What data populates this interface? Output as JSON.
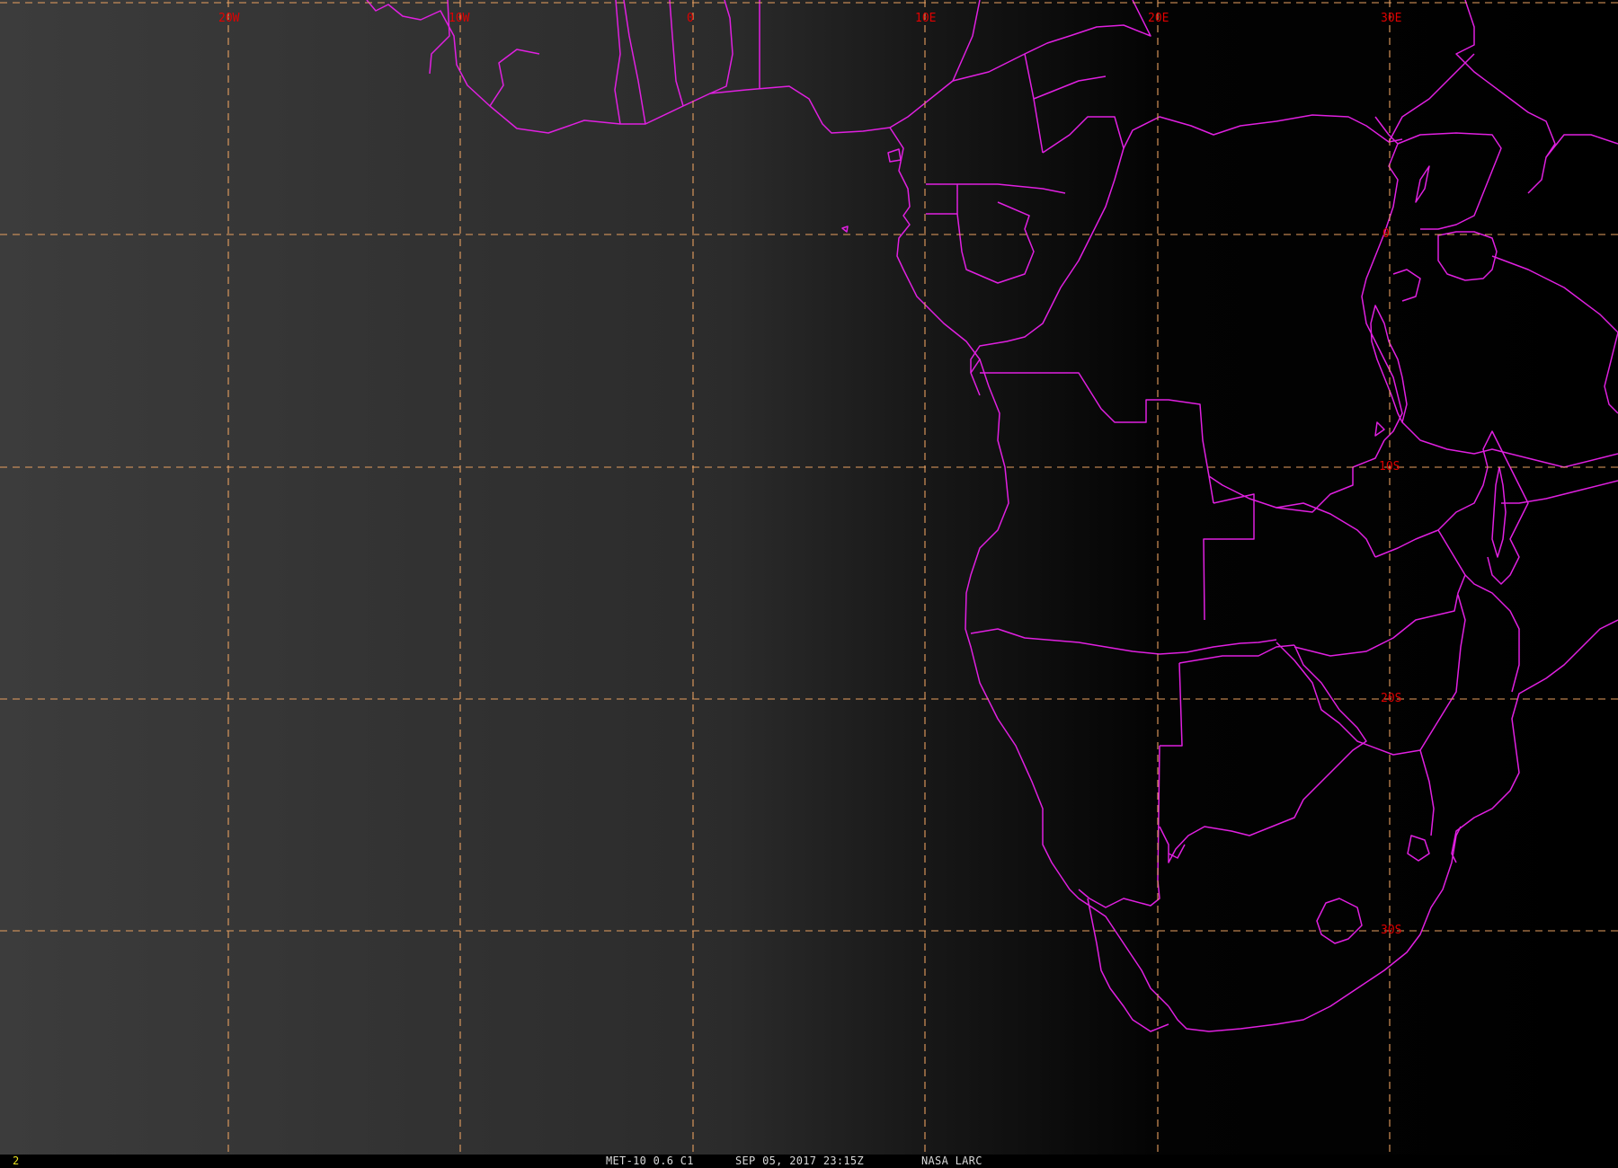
{
  "map": {
    "background_left": "#3a3a3a",
    "background_right": "#000000",
    "grid_color": "#e8a060",
    "border_color": "#e020e0",
    "label_color": "#e00000",
    "lon_labels": [
      "20W",
      "10W",
      "0",
      "10E",
      "20E",
      "30E"
    ],
    "lat_labels": [
      "0",
      "10S",
      "20S",
      "30S"
    ]
  },
  "status_bar": {
    "frame_number": "2",
    "satellite": "MET-10 0.6 C1",
    "datetime": "SEP 05, 2017 23:15Z",
    "organization": "NASA LARC"
  }
}
